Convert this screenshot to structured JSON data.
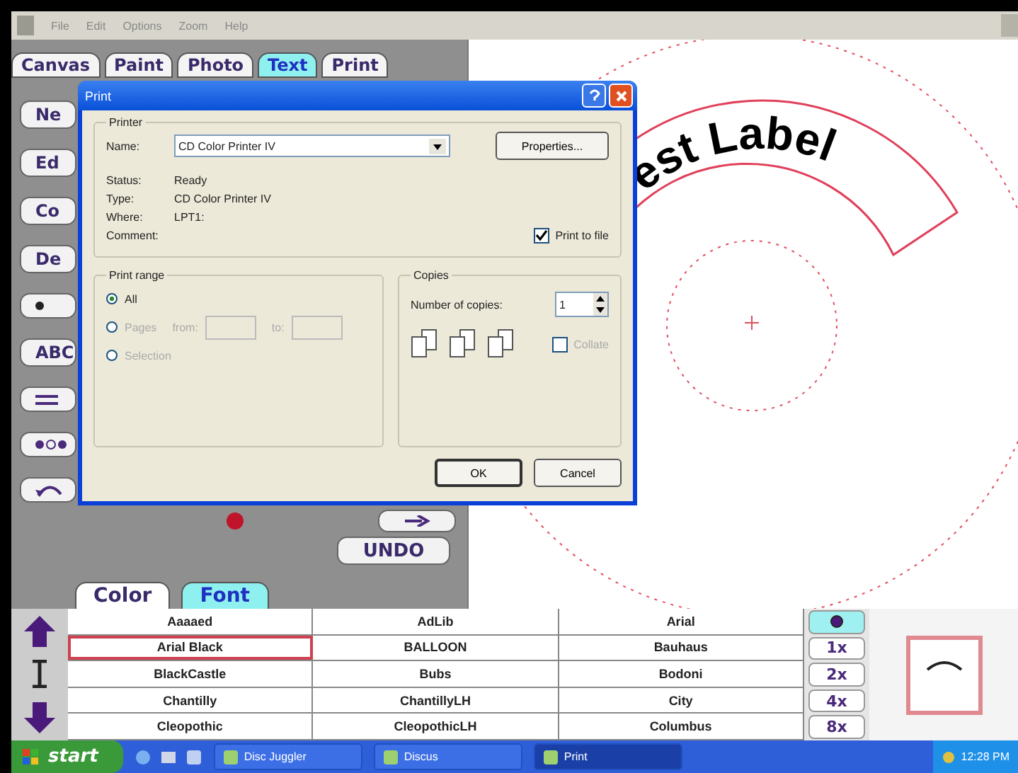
{
  "menu": [
    "File",
    "Edit",
    "Options",
    "Zoom",
    "Help"
  ],
  "tabs": [
    {
      "label": "Canvas",
      "selected": false
    },
    {
      "label": "Paint",
      "selected": false
    },
    {
      "label": "Photo",
      "selected": false
    },
    {
      "label": "Text",
      "selected": true
    },
    {
      "label": "Print",
      "selected": false
    }
  ],
  "tool_buttons": [
    {
      "kind": "text",
      "label": "Ne"
    },
    {
      "kind": "text",
      "label": "Ed"
    },
    {
      "kind": "text",
      "label": "Co"
    },
    {
      "kind": "text",
      "label": "De"
    },
    {
      "kind": "dot"
    },
    {
      "kind": "text",
      "label": "ABC"
    },
    {
      "kind": "lines"
    },
    {
      "kind": "spread"
    },
    {
      "kind": "curve"
    }
  ],
  "undo_button": "UNDO",
  "panel_tabs": [
    {
      "label": "Color",
      "selected": false
    },
    {
      "label": "Font",
      "selected": true
    }
  ],
  "fonts": [
    {
      "name": "Aaaaed",
      "selected": false
    },
    {
      "name": "AdLib",
      "selected": false
    },
    {
      "name": "Arial",
      "selected": false
    },
    {
      "name": "Arial Black",
      "selected": true
    },
    {
      "name": "BALLOON",
      "selected": false
    },
    {
      "name": "Bauhaus",
      "selected": false
    },
    {
      "name": "BlackCastle",
      "selected": false
    },
    {
      "name": "Bubs",
      "selected": false
    },
    {
      "name": "Bodoni",
      "selected": false
    },
    {
      "name": "Chantilly",
      "selected": false
    },
    {
      "name": "ChantillyLH",
      "selected": false
    },
    {
      "name": "City",
      "selected": false
    },
    {
      "name": "Cleopothic",
      "selected": false
    },
    {
      "name": "CleopothicLH",
      "selected": false
    },
    {
      "name": "Columbus",
      "selected": false
    }
  ],
  "zoom_levels": [
    "1x",
    "2x",
    "4x",
    "8x"
  ],
  "canvas": {
    "label_text": "est Label"
  },
  "dialog": {
    "title": "Print",
    "printer": {
      "group": "Printer",
      "name_label": "Name:",
      "name_value": "CD Color Printer IV",
      "properties_button": "Properties...",
      "status_label": "Status:",
      "status": "Ready",
      "type_label": "Type:",
      "type": "CD Color Printer IV",
      "where_label": "Where:",
      "where": "LPT1:",
      "comment_label": "Comment:",
      "print_to_file": {
        "label": "Print to file",
        "checked": true
      }
    },
    "print_range": {
      "group": "Print range",
      "options": [
        {
          "label": "All",
          "selected": true,
          "disabled": false
        },
        {
          "label": "Pages",
          "selected": false,
          "disabled": true
        },
        {
          "label": "Selection",
          "selected": false,
          "disabled": true
        }
      ],
      "from_label": "from:",
      "to_label": "to:"
    },
    "copies": {
      "group": "Copies",
      "number_label": "Number of copies:",
      "number": "1",
      "collate": {
        "label": "Collate",
        "checked": false,
        "disabled": true
      }
    },
    "buttons": [
      "OK",
      "Cancel"
    ]
  },
  "taskbar": {
    "start": "start",
    "tasks": [
      {
        "label": "Disc Juggler",
        "selected": false
      },
      {
        "label": "Discus",
        "selected": false
      },
      {
        "label": "Print",
        "selected": true
      }
    ],
    "clock": "12:28 PM"
  }
}
